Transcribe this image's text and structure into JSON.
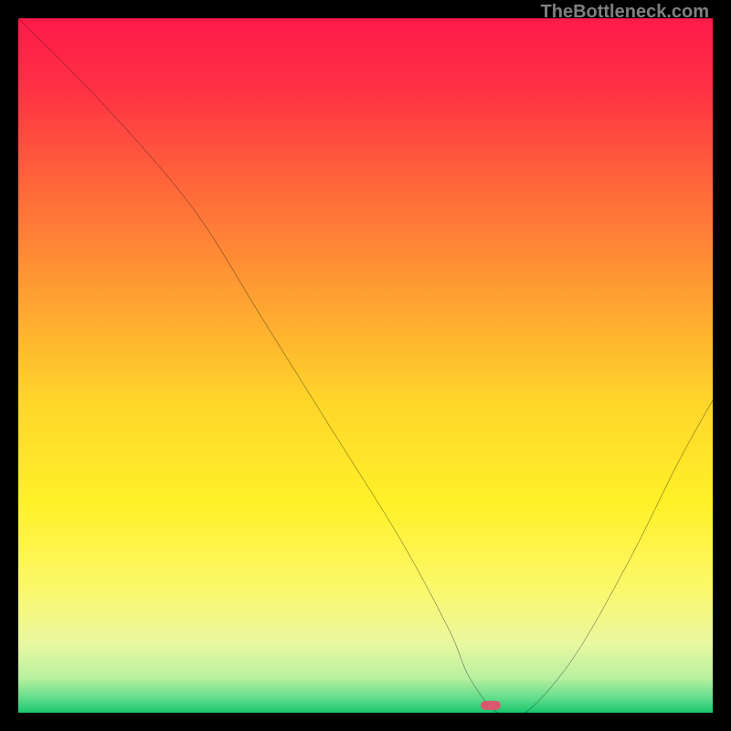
{
  "watermark": "TheBottleneck.com",
  "chart_data": {
    "type": "line",
    "title": "",
    "xlabel": "",
    "ylabel": "",
    "xlim": [
      0,
      100
    ],
    "ylim": [
      0,
      100
    ],
    "x": [
      0,
      10,
      20,
      27,
      35,
      45,
      55,
      62,
      65,
      69,
      73,
      80,
      88,
      95,
      100
    ],
    "values": [
      100,
      90,
      79,
      70,
      57,
      41,
      25,
      12,
      5,
      0,
      0,
      8,
      22,
      36,
      45
    ],
    "notes": "V-shaped bottleneck curve; minimum near x≈69–73; left branch starts at top-left corner with a slight kink around x≈27."
  },
  "gradient_stops": [
    {
      "offset": 0.0,
      "color": "#ff1a4a"
    },
    {
      "offset": 0.1,
      "color": "#ff3045"
    },
    {
      "offset": 0.25,
      "color": "#ff6a3a"
    },
    {
      "offset": 0.4,
      "color": "#ffa032"
    },
    {
      "offset": 0.55,
      "color": "#ffd52a"
    },
    {
      "offset": 0.7,
      "color": "#fff128"
    },
    {
      "offset": 0.82,
      "color": "#fbf86a"
    },
    {
      "offset": 0.9,
      "color": "#e9f8a0"
    },
    {
      "offset": 0.95,
      "color": "#b8f0a0"
    },
    {
      "offset": 0.98,
      "color": "#5fdc8a"
    },
    {
      "offset": 1.0,
      "color": "#19c76f"
    }
  ],
  "marker": {
    "x_percent": 68,
    "y_percent": 99,
    "color": "#d9596e"
  }
}
